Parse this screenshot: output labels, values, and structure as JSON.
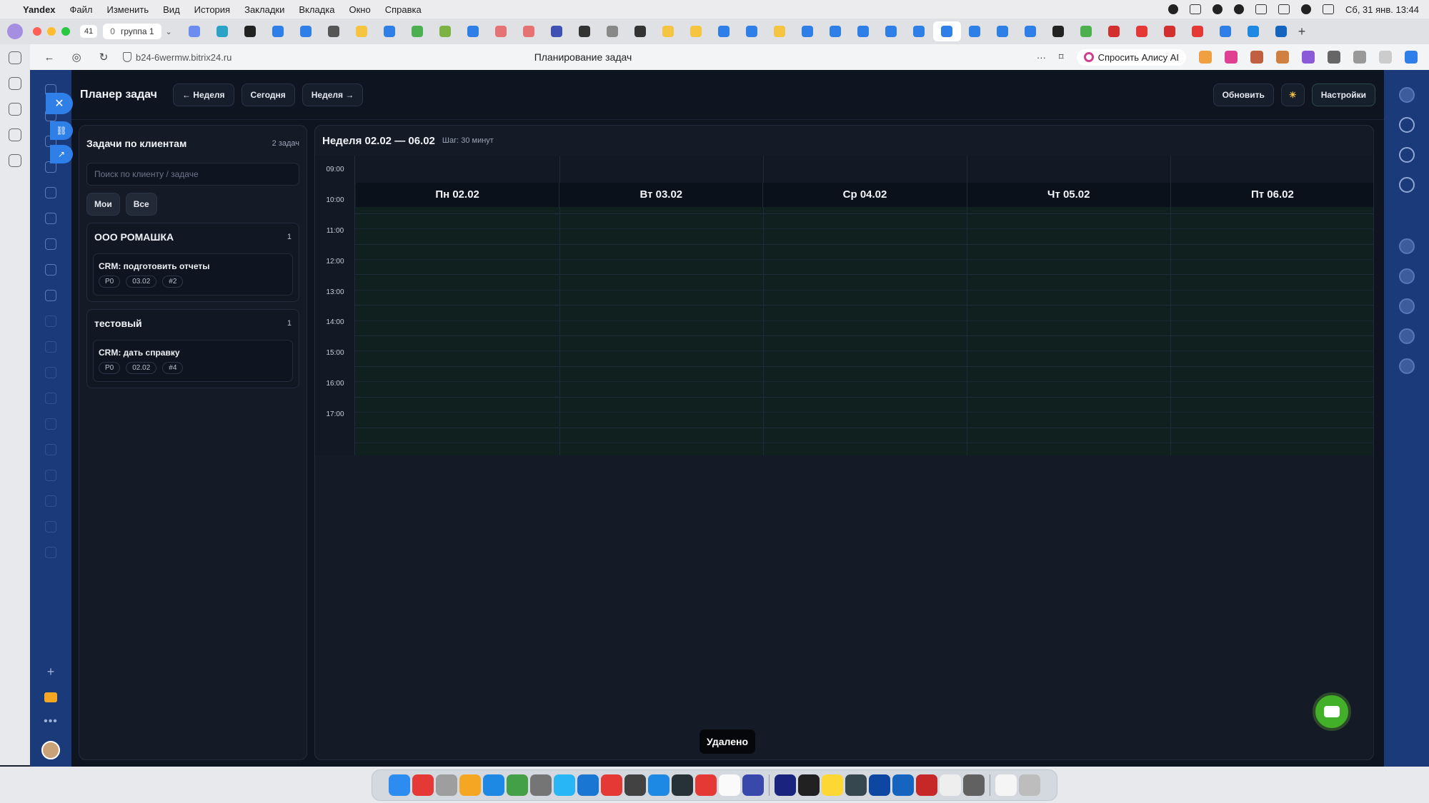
{
  "menubar": {
    "app": "Yandex",
    "items": [
      "Файл",
      "Изменить",
      "Вид",
      "История",
      "Закладки",
      "Вкладка",
      "Окно",
      "Справка"
    ],
    "clock": "Сб, 31 янв. 13:44"
  },
  "tabstrip": {
    "tab_count": "41",
    "group_zero": "0",
    "group_name": "группа 1"
  },
  "addressbar": {
    "url": "b24-6wermw.bitrix24.ru",
    "page_title": "Планирование задач",
    "alice_label": "Спросить Алису AI"
  },
  "planner": {
    "title": "Планер задач",
    "prev_week": "← Неделя",
    "today": "Сегодня",
    "next_week": "Неделя →",
    "refresh": "Обновить",
    "theme_icon": "☀",
    "settings": "Настройки"
  },
  "tasks_panel": {
    "title": "Задачи по клиентам",
    "count": "2 задач",
    "search_placeholder": "Поиск по клиенту / задаче",
    "filter_mine": "Мои",
    "filter_all": "Все",
    "groups": [
      {
        "name": "ООО РОМАШКА",
        "count": "1",
        "tasks": [
          {
            "title": "CRM: подготовить отчеты",
            "priority": "P0",
            "date": "03.02",
            "id": "#2"
          }
        ]
      },
      {
        "name": "тестовый",
        "count": "1",
        "tasks": [
          {
            "title": "CRM: дать справку",
            "priority": "P0",
            "date": "02.02",
            "id": "#4"
          }
        ]
      }
    ]
  },
  "calendar": {
    "title": "Неделя 02.02 — 06.02",
    "step": "Шаг: 30 минут",
    "hours": [
      "09:00",
      "10:00",
      "11:00",
      "12:00",
      "13:00",
      "14:00",
      "15:00",
      "16:00",
      "17:00"
    ],
    "days": [
      "Пн 02.02",
      "Вт 03.02",
      "Ср 04.02",
      "Чт 05.02",
      "Пт 06.02"
    ]
  },
  "toast": {
    "text": "Удалено"
  },
  "icons": {
    "close": "close-icon",
    "chat": "chat-icon",
    "theme": "sun-icon"
  },
  "colors": {
    "accent_blue": "#2f7fe8",
    "bitrix_blue": "#1a3a7a",
    "chat_green": "#43b02a",
    "planner_bg": "#0f1520"
  }
}
